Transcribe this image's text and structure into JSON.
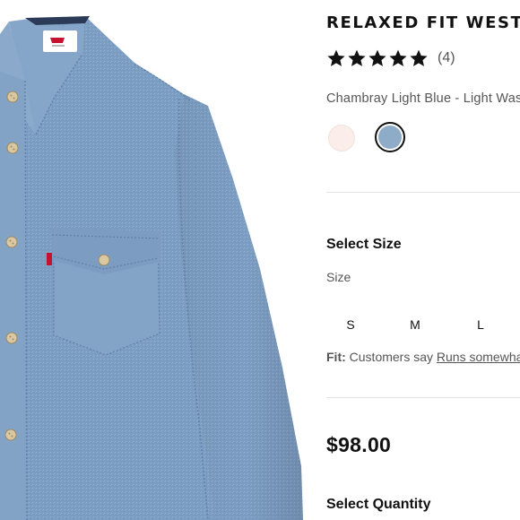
{
  "product": {
    "title": "RELAXED FIT WESTERN SHIRT",
    "rating": {
      "stars": 5,
      "review_count": "(4)"
    },
    "color_name": "Chambray Light Blue - Light Wash",
    "swatches": [
      {
        "name": "swatch-pale-pink",
        "color": "#fbeeea",
        "selected": false
      },
      {
        "name": "swatch-chambray-blue",
        "color": "#8eabc7",
        "selected": true
      }
    ]
  },
  "size_section": {
    "heading": "Select Size",
    "label": "Size",
    "options": [
      "S",
      "M",
      "L"
    ],
    "fit_prefix": "Fit:",
    "fit_text": "Customers say",
    "fit_link": "Runs somewhat"
  },
  "price": "$98.00",
  "quantity_section": {
    "heading": "Select Quantity"
  },
  "image": {
    "brand_tab_color": "#c41230",
    "shirt_color": "#7c9dc2"
  }
}
